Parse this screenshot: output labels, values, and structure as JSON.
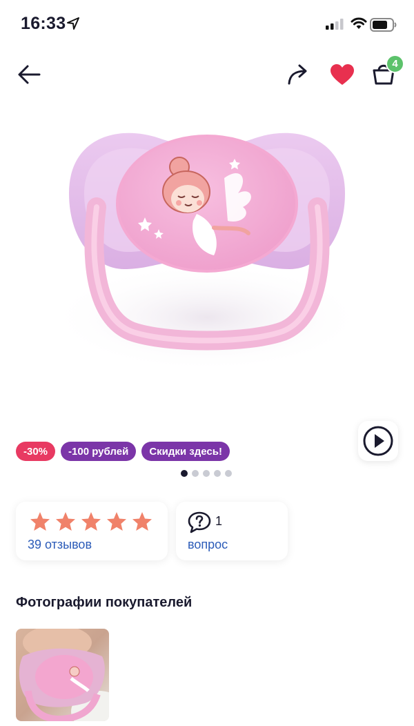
{
  "status_bar": {
    "time": "16:33",
    "icons": [
      "location-arrow-icon",
      "cellular-signal-icon",
      "wifi-icon",
      "battery-icon"
    ]
  },
  "nav": {
    "icons": [
      "back-arrow-icon",
      "share-icon",
      "heart-icon",
      "cart-icon"
    ],
    "cart_count": "4",
    "heart_color": "#e8304f",
    "badge_color": "#5cc26b"
  },
  "product": {
    "image": "pink pacifier with ballerina fairy print"
  },
  "promo_badges": [
    {
      "label": "-30%",
      "color": "#e83a62"
    },
    {
      "label": "-100 рублей",
      "color": "#7b35a8"
    },
    {
      "label": "Скидки здесь!",
      "color": "#7b35a8"
    }
  ],
  "carousel": {
    "total": 5,
    "active": 1
  },
  "rating": {
    "stars": 5,
    "star_color": "#f0826a",
    "reviews_label": "39 отзывов"
  },
  "questions": {
    "count": "1",
    "label": "вопрос"
  },
  "customer_photos": {
    "title": "Фотографии покупателей"
  },
  "colors": {
    "link": "#2b5bb8",
    "text": "#1a1a2e"
  }
}
